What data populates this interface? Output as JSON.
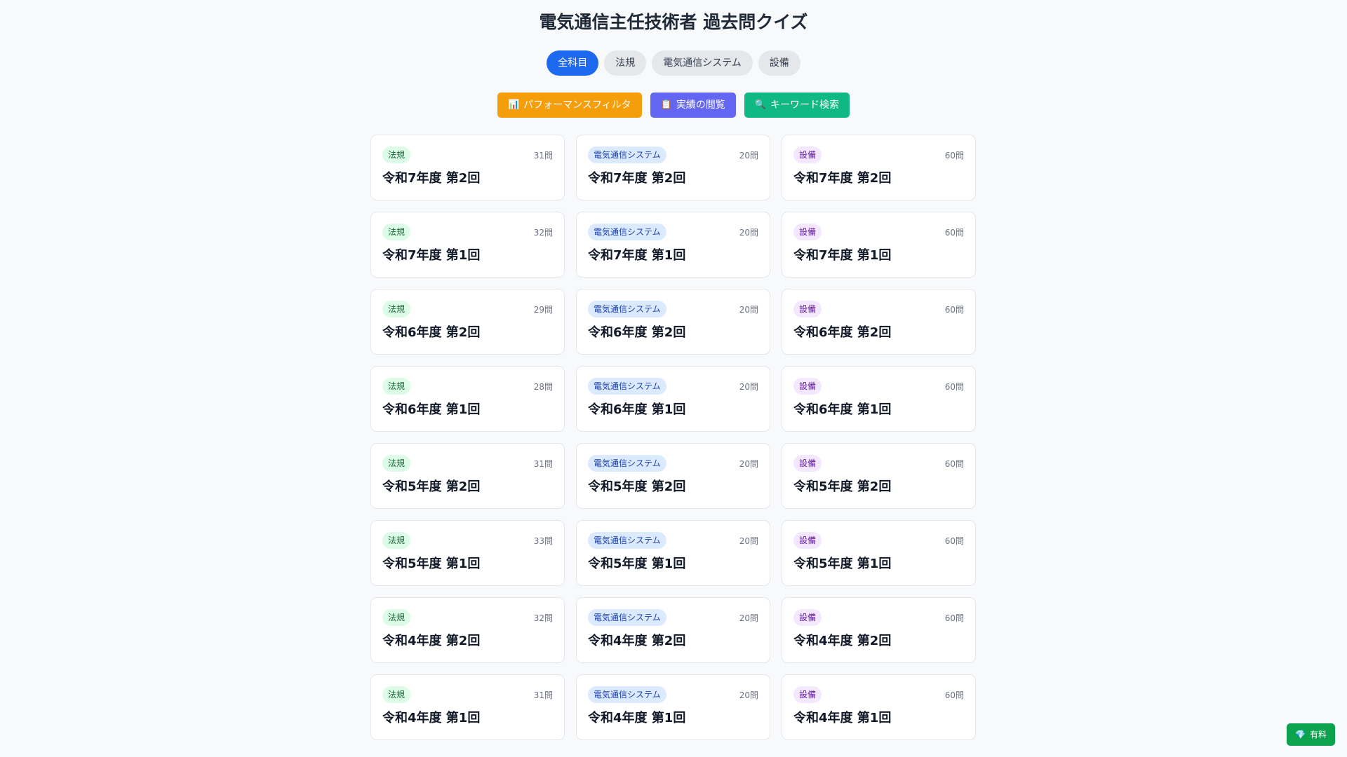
{
  "header": {
    "title": "電気通信主任技術者 過去問クイズ"
  },
  "tabs": [
    {
      "label": "全科目",
      "active": true
    },
    {
      "label": "法規",
      "active": false
    },
    {
      "label": "電気通信システム",
      "active": false
    },
    {
      "label": "設備",
      "active": false
    }
  ],
  "actions": [
    {
      "icon": "chart-icon",
      "glyph": "📊",
      "label": "パフォーマンスフィルタ",
      "color": "#f59e0b"
    },
    {
      "icon": "clipboard-icon",
      "glyph": "📋",
      "label": "実績の閲覧",
      "color": "#6366f1"
    },
    {
      "icon": "search-icon",
      "glyph": "🔍",
      "label": "キーワード検索",
      "color": "#10b981"
    }
  ],
  "cards": [
    {
      "badge": "法規",
      "kind": "law",
      "count": "31問",
      "title": "令和7年度 第2回"
    },
    {
      "badge": "電気通信システム",
      "kind": "sys",
      "count": "20問",
      "title": "令和7年度 第2回"
    },
    {
      "badge": "設備",
      "kind": "eq",
      "count": "60問",
      "title": "令和7年度 第2回"
    },
    {
      "badge": "法規",
      "kind": "law",
      "count": "32問",
      "title": "令和7年度 第1回"
    },
    {
      "badge": "電気通信システム",
      "kind": "sys",
      "count": "20問",
      "title": "令和7年度 第1回"
    },
    {
      "badge": "設備",
      "kind": "eq",
      "count": "60問",
      "title": "令和7年度 第1回"
    },
    {
      "badge": "法規",
      "kind": "law",
      "count": "29問",
      "title": "令和6年度 第2回"
    },
    {
      "badge": "電気通信システム",
      "kind": "sys",
      "count": "20問",
      "title": "令和6年度 第2回"
    },
    {
      "badge": "設備",
      "kind": "eq",
      "count": "60問",
      "title": "令和6年度 第2回"
    },
    {
      "badge": "法規",
      "kind": "law",
      "count": "28問",
      "title": "令和6年度 第1回"
    },
    {
      "badge": "電気通信システム",
      "kind": "sys",
      "count": "20問",
      "title": "令和6年度 第1回"
    },
    {
      "badge": "設備",
      "kind": "eq",
      "count": "60問",
      "title": "令和6年度 第1回"
    },
    {
      "badge": "法規",
      "kind": "law",
      "count": "31問",
      "title": "令和5年度 第2回"
    },
    {
      "badge": "電気通信システム",
      "kind": "sys",
      "count": "20問",
      "title": "令和5年度 第2回"
    },
    {
      "badge": "設備",
      "kind": "eq",
      "count": "60問",
      "title": "令和5年度 第2回"
    },
    {
      "badge": "法規",
      "kind": "law",
      "count": "33問",
      "title": "令和5年度 第1回"
    },
    {
      "badge": "電気通信システム",
      "kind": "sys",
      "count": "20問",
      "title": "令和5年度 第1回"
    },
    {
      "badge": "設備",
      "kind": "eq",
      "count": "60問",
      "title": "令和5年度 第1回"
    },
    {
      "badge": "法規",
      "kind": "law",
      "count": "32問",
      "title": "令和4年度 第2回"
    },
    {
      "badge": "電気通信システム",
      "kind": "sys",
      "count": "20問",
      "title": "令和4年度 第2回"
    },
    {
      "badge": "設備",
      "kind": "eq",
      "count": "60問",
      "title": "令和4年度 第2回"
    },
    {
      "badge": "法規",
      "kind": "law",
      "count": "31問",
      "title": "令和4年度 第1回"
    },
    {
      "badge": "電気通信システム",
      "kind": "sys",
      "count": "20問",
      "title": "令和4年度 第1回"
    },
    {
      "badge": "設備",
      "kind": "eq",
      "count": "60問",
      "title": "令和4年度 第1回"
    }
  ],
  "paid_button": {
    "icon": "gem-icon",
    "glyph": "💎",
    "label": "有料",
    "color": "#0ba34e"
  }
}
